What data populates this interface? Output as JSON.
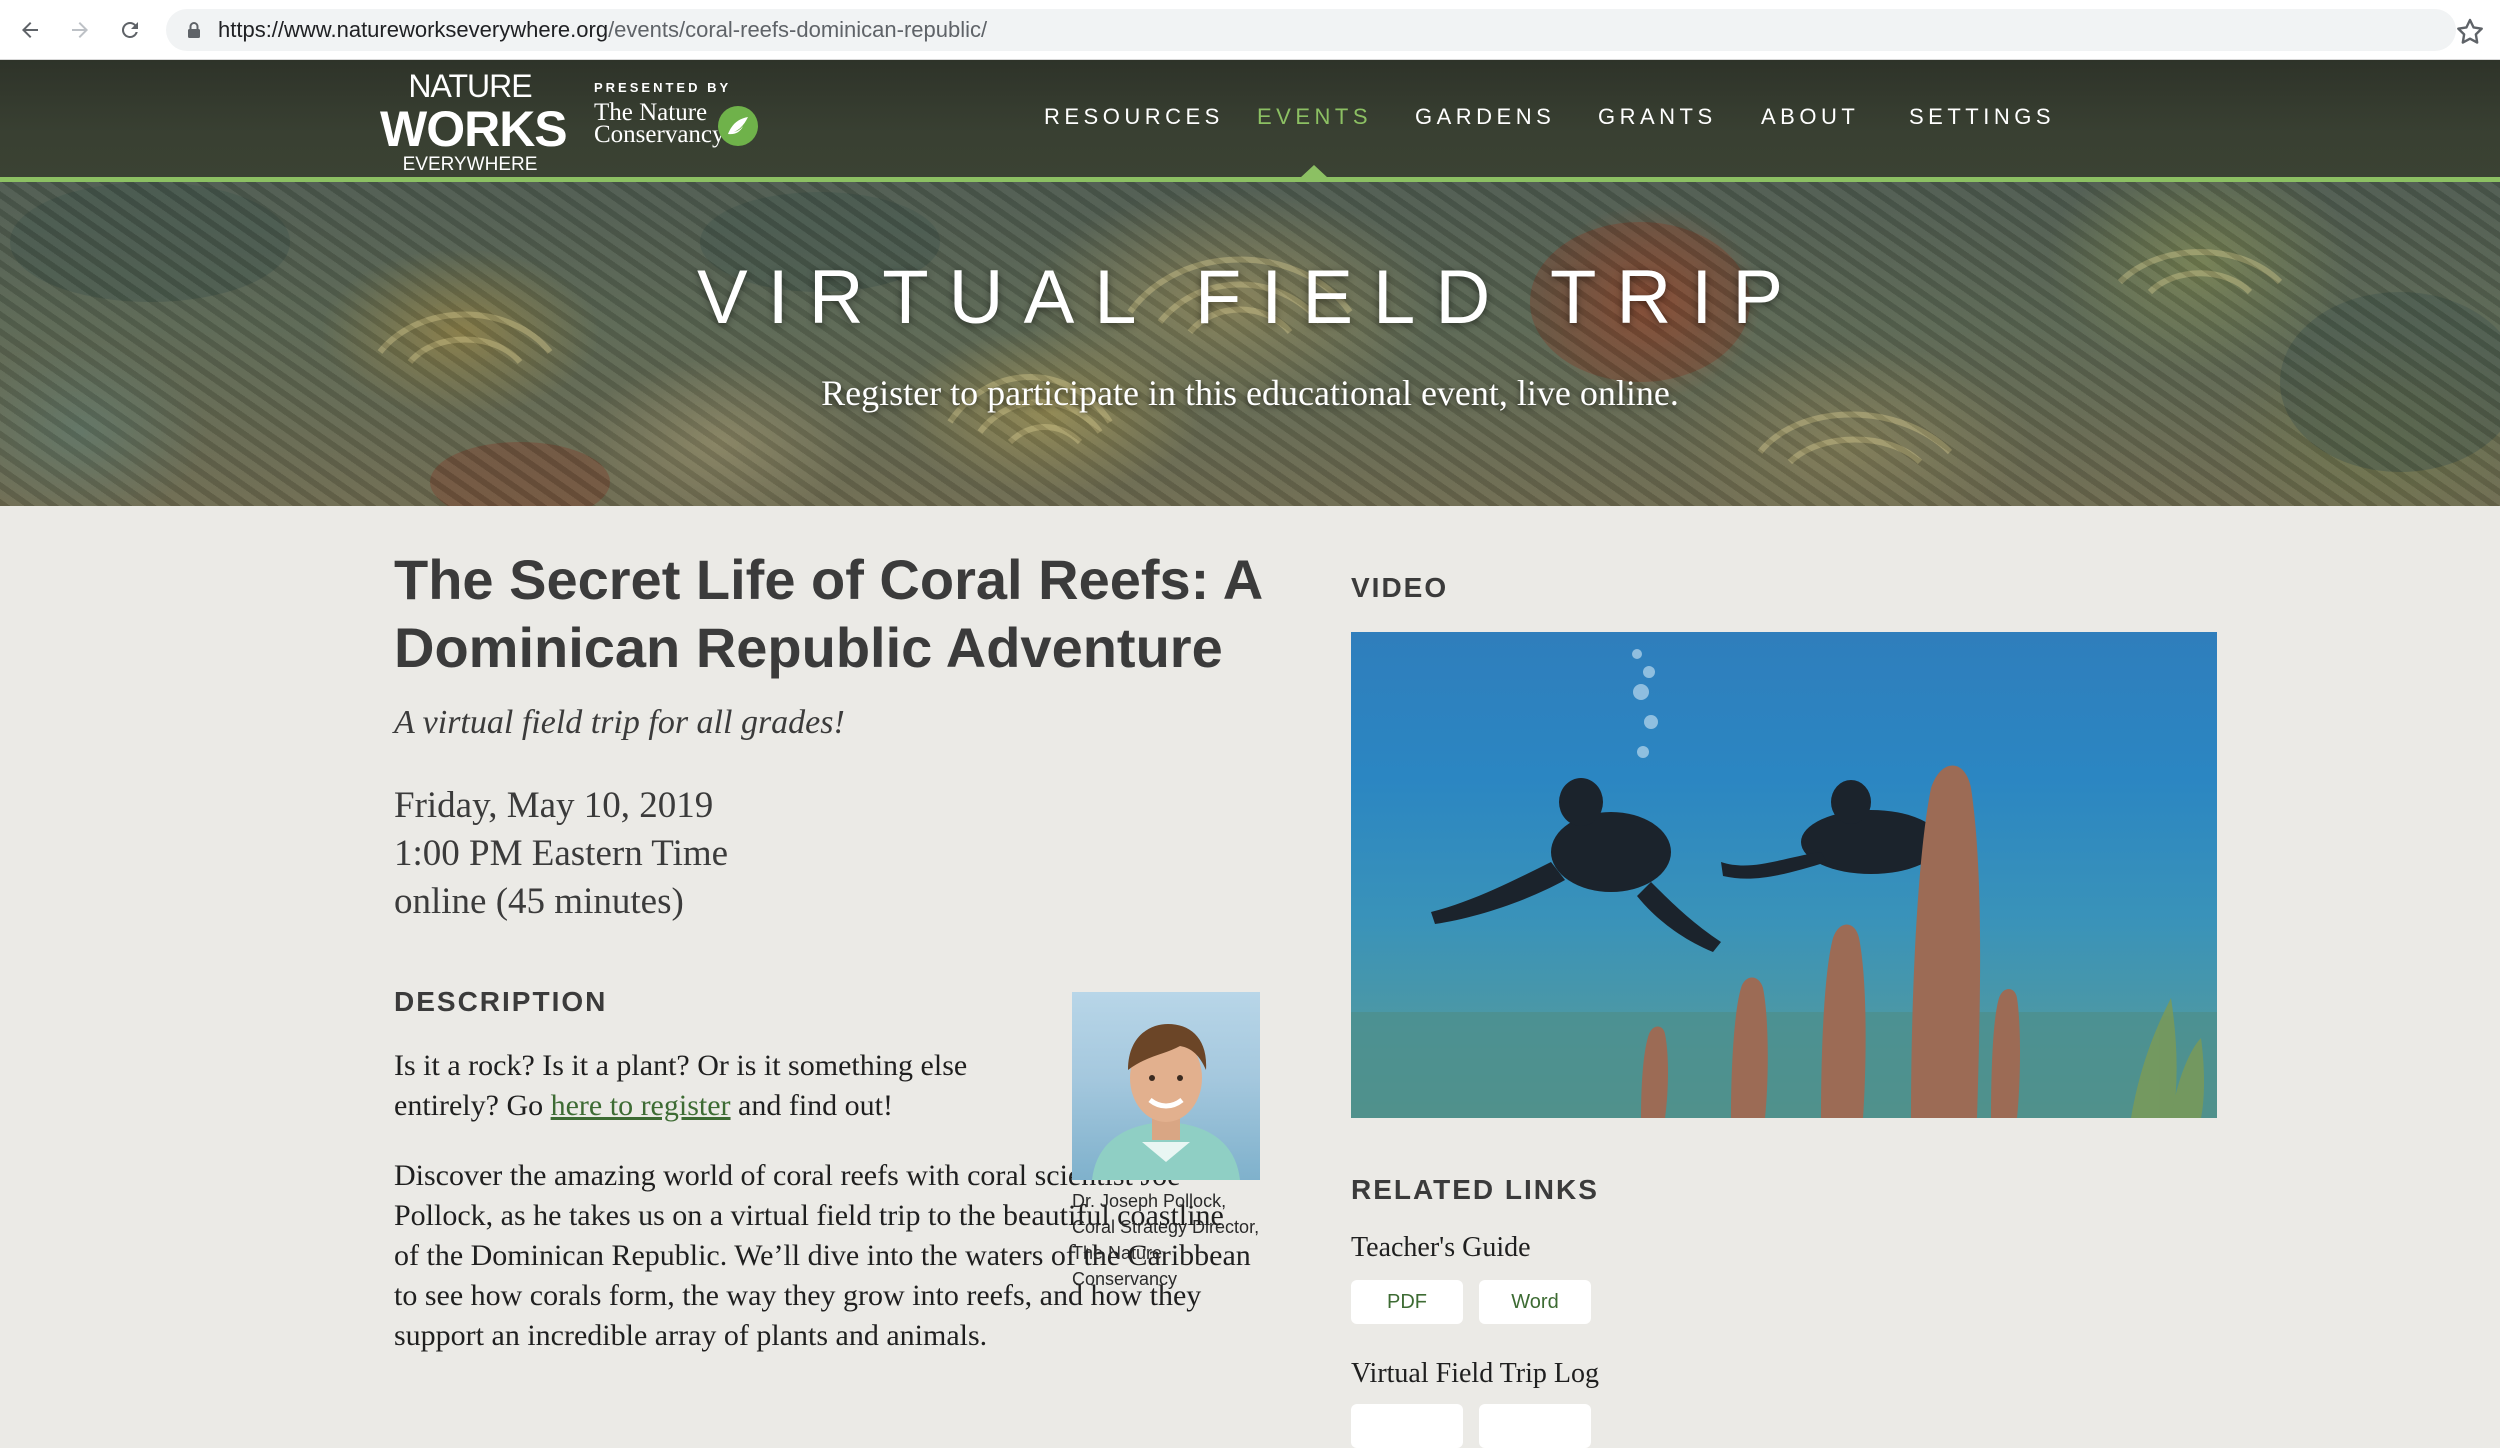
{
  "browser": {
    "url_host": "https://www.natureworkseverywhere.org",
    "url_path": "/events/coral-reefs-dominican-republic/"
  },
  "logo": {
    "line1": "NATURE",
    "line2": "WORKS",
    "line3": "EVERYWHERE"
  },
  "presented": {
    "by": "PRESENTED BY",
    "org_line1": "The Nature",
    "org_line2": "Conservancy"
  },
  "nav": {
    "items": [
      "RESOURCES",
      "EVENTS",
      "GARDENS",
      "GRANTS",
      "ABOUT",
      "SETTINGS"
    ],
    "active": "EVENTS"
  },
  "hero": {
    "title": "VIRTUAL FIELD TRIP",
    "subtitle": "Register to participate in this educational event, live online."
  },
  "event": {
    "title": "The Secret Life of Coral Reefs: A Dominican Republic Adventure",
    "subtitle": "A virtual field trip for all grades!",
    "date": "Friday, May 10, 2019",
    "time": "1:00 PM Eastern Time",
    "duration": "online (45 minutes)"
  },
  "description": {
    "heading": "DESCRIPTION",
    "p1_before": "Is it a rock? Is it a plant? Or is it something else entirely? Go ",
    "p1_link": "here to register",
    "p1_after": " and find out!",
    "p2": "Discover the amazing world of coral reefs with coral scientist Joe Pollock, as he takes us on a virtual field trip to the beautiful coastline of the Dominican Republic. We’ll dive into the waters of the Caribbean to see how corals form, the way they grow into reefs, and how they support an incredible array of plants and animals.",
    "photo_caption": "Dr. Joseph Pollock, Coral Strategy Director, The Nature Conservancy"
  },
  "video": {
    "heading": "VIDEO"
  },
  "related": {
    "heading": "RELATED LINKS",
    "teachers_guide": "Teacher's Guide",
    "pdf": "PDF",
    "word": "Word",
    "field_trip_log": "Virtual Field Trip Log"
  },
  "colors": {
    "accent_green": "#8cc063",
    "link_green": "#3d6b33",
    "header_bg": "#343a2f",
    "page_bg": "#ebeae6"
  },
  "icons": [
    "back-arrow-icon",
    "forward-arrow-icon",
    "reload-icon",
    "lock-icon",
    "star-icon",
    "nature-conservancy-leaf-icon"
  ]
}
